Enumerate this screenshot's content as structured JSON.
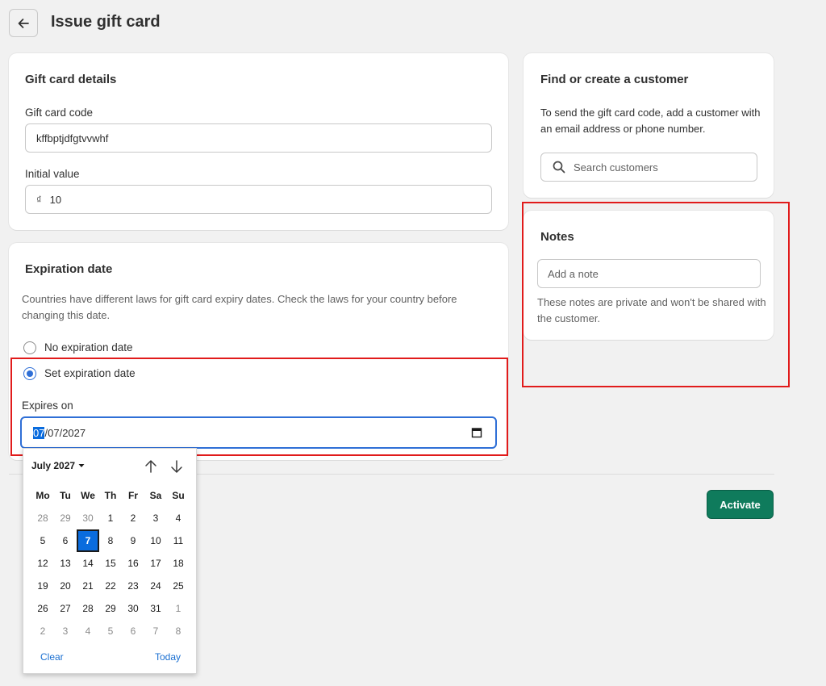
{
  "header": {
    "title": "Issue gift card"
  },
  "gift_card_details": {
    "title": "Gift card details",
    "code_label": "Gift card code",
    "code_value": "kffbptjdfgtvvwhf",
    "value_label": "Initial value",
    "currency_symbol": "₫",
    "value": "10"
  },
  "expiration": {
    "title": "Expiration date",
    "help": "Countries have different laws for gift card expiry dates. Check the laws for your country before changing this date.",
    "option_none": "No expiration date",
    "option_set": "Set expiration date",
    "selected_option": "Set expiration date",
    "expires_label": "Expires on",
    "date_segments": {
      "month": "07",
      "day": "07",
      "year": "2027"
    },
    "sep": "/"
  },
  "customer": {
    "title": "Find or create a customer",
    "help": "To send the gift card code, add a customer with an email address or phone number.",
    "search_placeholder": "Search customers"
  },
  "notes": {
    "title": "Notes",
    "placeholder": "Add a note",
    "help": "These notes are private and won't be shared with the customer."
  },
  "actions": {
    "activate": "Activate"
  },
  "datepicker": {
    "month_label": "July 2027",
    "weekdays": [
      "Mo",
      "Tu",
      "We",
      "Th",
      "Fr",
      "Sa",
      "Su"
    ],
    "weeks": [
      [
        "28",
        "29",
        "30",
        "1",
        "2",
        "3",
        "4"
      ],
      [
        "5",
        "6",
        "7",
        "8",
        "9",
        "10",
        "11"
      ],
      [
        "12",
        "13",
        "14",
        "15",
        "16",
        "17",
        "18"
      ],
      [
        "19",
        "20",
        "21",
        "22",
        "23",
        "24",
        "25"
      ],
      [
        "26",
        "27",
        "28",
        "29",
        "30",
        "31",
        "1"
      ],
      [
        "2",
        "3",
        "4",
        "5",
        "6",
        "7",
        "8"
      ]
    ],
    "outside_month": [
      [
        true,
        true,
        true,
        false,
        false,
        false,
        false
      ],
      [
        false,
        false,
        false,
        false,
        false,
        false,
        false
      ],
      [
        false,
        false,
        false,
        false,
        false,
        false,
        false
      ],
      [
        false,
        false,
        false,
        false,
        false,
        false,
        false
      ],
      [
        false,
        false,
        false,
        false,
        false,
        false,
        true
      ],
      [
        true,
        true,
        true,
        true,
        true,
        true,
        true
      ]
    ],
    "selected_day": "7",
    "clear_label": "Clear",
    "today_label": "Today"
  },
  "colors": {
    "accent": "#0f7b5c",
    "highlight": "#e11b1b",
    "focus": "#2f6fd6",
    "selection": "#0a6cde"
  }
}
